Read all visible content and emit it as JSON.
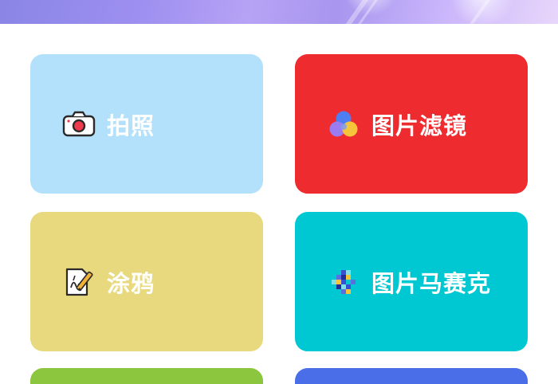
{
  "banner": {
    "gradient_colors": [
      "#8a86e6",
      "#b7a3f5",
      "#e8d6fb"
    ]
  },
  "tiles": [
    {
      "label": "拍照",
      "color": "#b3e1fc",
      "icon": "camera-icon"
    },
    {
      "label": "图片滤镜",
      "color": "#ee2b2f",
      "icon": "color-circles-icon"
    },
    {
      "label": "涂鸦",
      "color": "#e8d97e",
      "icon": "doodle-icon"
    },
    {
      "label": "图片马赛克",
      "color": "#00c8d2",
      "icon": "mosaic-icon"
    }
  ],
  "partial_tiles": [
    {
      "color": "#8cc63f"
    },
    {
      "color": "#4a6ee8"
    }
  ]
}
